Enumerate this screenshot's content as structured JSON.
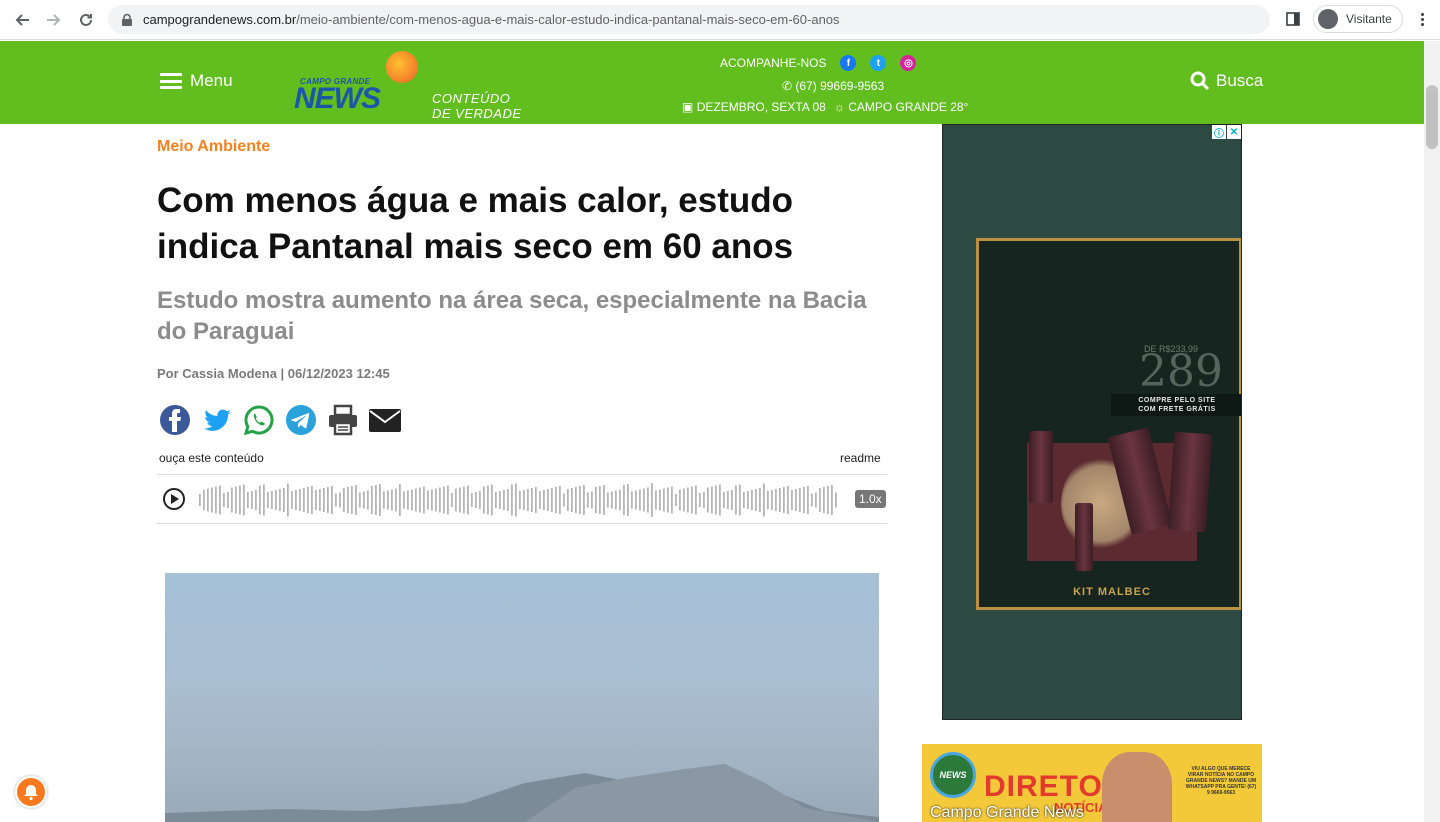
{
  "browser": {
    "url_domain": "campograndenews.com.br",
    "url_path": "/meio-ambiente/com-menos-agua-e-mais-calor-estudo-indica-pantanal-mais-seco-em-60-anos",
    "profile_label": "Visitante"
  },
  "header": {
    "menu_label": "Menu",
    "logo_small": "CAMPO GRANDE",
    "logo_big": "NEWS",
    "tagline_1": "CONTEÚDO",
    "tagline_2": "DE VERDADE",
    "follow_label": "ACOMPANHE-NOS",
    "phone": "(67) 99669-9563",
    "date": "DEZEMBRO, SEXTA  08",
    "weather": "CAMPO GRANDE 28°",
    "search_label": "Busca",
    "brand_color": "#62bd1f"
  },
  "article": {
    "category": "Meio Ambiente",
    "headline": "Com menos água e mais calor, estudo indica Pantanal mais seco em 60 anos",
    "subhead": "Estudo mostra aumento na área seca, especialmente na Bacia do Paraguai",
    "byline": "Por Cassia Modena | 06/12/2023 12:45",
    "audio_label": "ouça este conteúdo",
    "audio_brand": "readme",
    "audio_speed": "1.0x"
  },
  "ad": {
    "price_prefix": "DE R$233,99",
    "price": "289",
    "cta_line1": "COMPRE PELO SITE",
    "cta_line2": "COM FRETE GRÁTIS",
    "kit_label": "KIT MALBEC",
    "product_brand": "malbec"
  },
  "ad2": {
    "logo_text": "NEWS",
    "headline": "DIRETO",
    "sub": "NOTÍCIA",
    "side_text": "VIU ALGO QUE MERECE VIRAR NOTÍCIA NO CAMPO GRANDE NEWS? MANDE UM WHATSAPP PRA GENTE! (67) 9 9669-9563",
    "caption": "Campo Grande News"
  }
}
